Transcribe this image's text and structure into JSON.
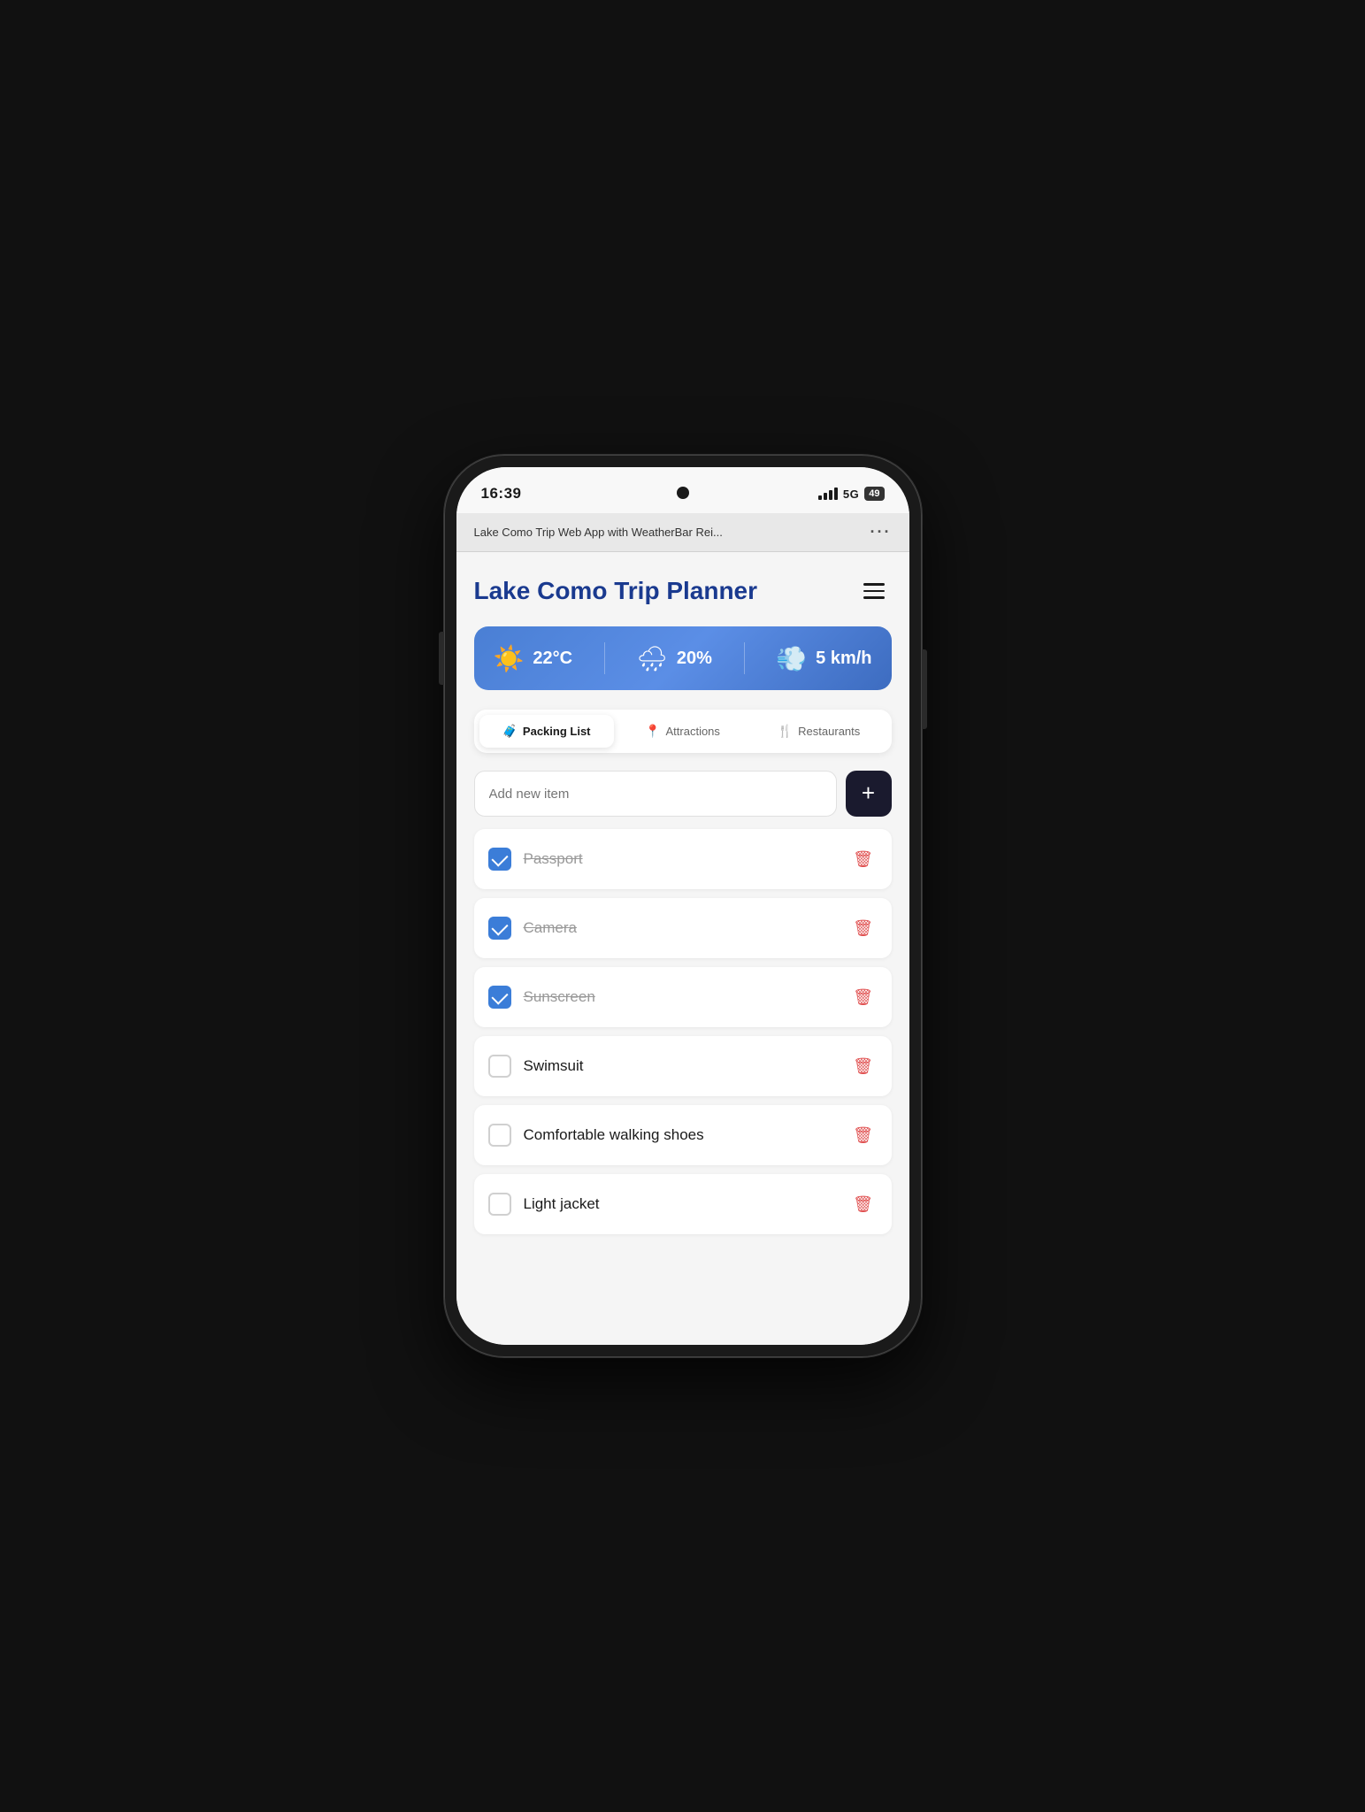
{
  "phone": {
    "time": "16:39",
    "signal_label": "5G",
    "battery_label": "49"
  },
  "browser": {
    "url_text": "Lake Como Trip Web App with WeatherBar Rei...",
    "menu_dots": "···"
  },
  "app": {
    "title": "Lake Como Trip Planner",
    "hamburger_label": "menu"
  },
  "weather": {
    "temp": "22°C",
    "rain_pct": "20%",
    "wind": "5 km/h"
  },
  "tabs": [
    {
      "id": "packing",
      "icon": "🧳",
      "label": "Packing List",
      "active": true
    },
    {
      "id": "attractions",
      "icon": "📍",
      "label": "Attractions",
      "active": false
    },
    {
      "id": "restaurants",
      "icon": "🍴",
      "label": "Restaurants",
      "active": false
    }
  ],
  "add_input": {
    "placeholder": "Add new item",
    "button_label": "+"
  },
  "packing_items": [
    {
      "id": 1,
      "label": "Passport",
      "checked": true
    },
    {
      "id": 2,
      "label": "Camera",
      "checked": true
    },
    {
      "id": 3,
      "label": "Sunscreen",
      "checked": true
    },
    {
      "id": 4,
      "label": "Swimsuit",
      "checked": false
    },
    {
      "id": 5,
      "label": "Comfortable walking shoes",
      "checked": false
    },
    {
      "id": 6,
      "label": "Light jacket",
      "checked": false
    }
  ]
}
